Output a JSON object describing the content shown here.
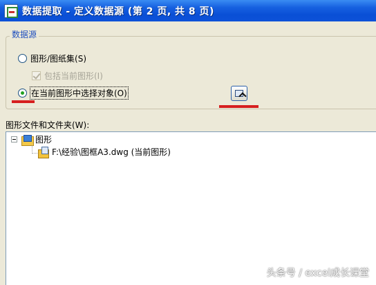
{
  "window": {
    "title": "数据提取 - 定义数据源 (第 2 页, 共 8 页)"
  },
  "data_source_group": {
    "legend": "数据源",
    "options": [
      {
        "label": "图形/图纸集(S)",
        "checked": false
      },
      {
        "label": "包括当前图形(I)",
        "checked": true,
        "disabled": true
      },
      {
        "label": "在当前图形中选择对象(O)",
        "checked": true,
        "focused": true
      }
    ],
    "select_objects_button_icon": "select-objects-icon"
  },
  "tree": {
    "label": "图形文件和文件夹(W):",
    "root": {
      "label": "图形",
      "icon": "drawing-folder-icon",
      "expanded": true
    },
    "children": [
      {
        "label": "F:\\经验\\图框A3.dwg (当前图形)",
        "icon": "dwg-file-icon"
      }
    ]
  },
  "annotations": {
    "red_underline_color": "#d61f1f"
  },
  "watermark": {
    "text": "头条号 / excel成长课堂"
  }
}
